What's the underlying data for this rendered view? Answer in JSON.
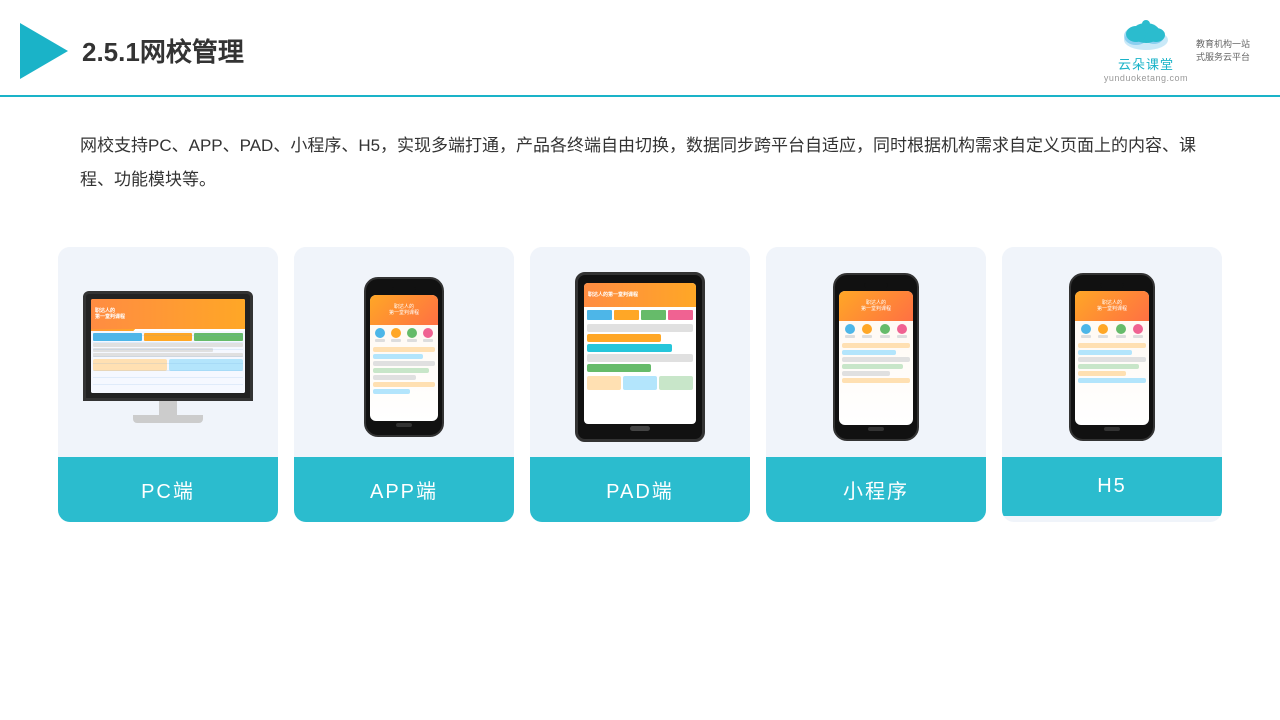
{
  "header": {
    "title": "2.5.1网校管理",
    "brand": {
      "name": "云朵课堂",
      "url": "yunduoketang.com",
      "tagline": "教育机构一站\n式服务云平台"
    }
  },
  "description": "网校支持PC、APP、PAD、小程序、H5，实现多端打通，产品各终端自由切换，数据同步跨平台自适应，同时根据机构需求自定义页面上的内容、课程、功能模块等。",
  "cards": [
    {
      "id": "pc",
      "label": "PC端",
      "device": "pc"
    },
    {
      "id": "app",
      "label": "APP端",
      "device": "phone"
    },
    {
      "id": "pad",
      "label": "PAD端",
      "device": "tablet"
    },
    {
      "id": "miniprogram",
      "label": "小程序",
      "device": "phone"
    },
    {
      "id": "h5",
      "label": "H5",
      "device": "phone"
    }
  ],
  "accent_color": "#2bbcce"
}
